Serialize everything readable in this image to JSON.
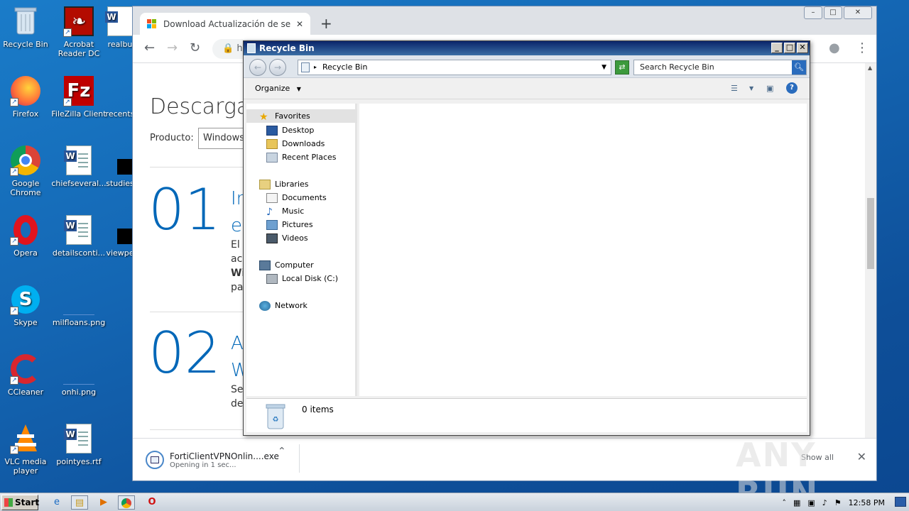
{
  "desktop": {
    "icons": [
      {
        "label": "Recycle Bin",
        "icon": "recycle-bin-icon"
      },
      {
        "label": "Acrobat Reader DC",
        "icon": "acrobat-icon"
      },
      {
        "label": "realbu",
        "icon": "word-doc-icon"
      },
      {
        "label": "Firefox",
        "icon": "firefox-icon"
      },
      {
        "label": "FileZilla Client",
        "icon": "filezilla-icon"
      },
      {
        "label": "recents",
        "icon": "file-icon"
      },
      {
        "label": "Google Chrome",
        "icon": "chrome-icon"
      },
      {
        "label": "chiefseveral...",
        "icon": "word-doc-icon"
      },
      {
        "label": "studies",
        "icon": "black-file-icon"
      },
      {
        "label": "Opera",
        "icon": "opera-icon"
      },
      {
        "label": "detailsconti...",
        "icon": "word-doc-icon"
      },
      {
        "label": "viewpe",
        "icon": "black-file-icon"
      },
      {
        "label": "Skype",
        "icon": "skype-icon"
      },
      {
        "label": "milfloans.png",
        "icon": "png-icon"
      },
      {
        "label": "CCleaner",
        "icon": "ccleaner-icon"
      },
      {
        "label": "onhi.png",
        "icon": "png-icon"
      },
      {
        "label": "VLC media player",
        "icon": "vlc-icon"
      },
      {
        "label": "pointyes.rtf",
        "icon": "word-doc-icon"
      }
    ]
  },
  "chrome": {
    "tab_title": "Download Actualización de segurida",
    "url": "ht",
    "page": {
      "heading": "Descargas",
      "product_label": "Producto:",
      "product_value": "Windows",
      "step1_num": "01",
      "step1_title1": "Ir",
      "step1_title2": "e",
      "step1_lines": [
        "El",
        "ac",
        "Wi",
        "pa"
      ],
      "step2_num": "02",
      "step2_title1": "A",
      "step2_title2": "W",
      "step2_lines": [
        "Se",
        "de"
      ]
    },
    "download": {
      "filename": "FortiClientVPNOnlin....exe",
      "status": "Opening in 1 sec...",
      "show_all": "Show all"
    }
  },
  "explorer": {
    "title": "Recycle Bin",
    "address": "Recycle Bin",
    "search_placeholder": "Search Recycle Bin",
    "organize": "Organize",
    "nav": {
      "favorites": "Favorites",
      "desktop": "Desktop",
      "downloads": "Downloads",
      "recent": "Recent Places",
      "libraries": "Libraries",
      "documents": "Documents",
      "music": "Music",
      "pictures": "Pictures",
      "videos": "Videos",
      "computer": "Computer",
      "localdisk": "Local Disk (C:)",
      "network": "Network"
    },
    "item_count": "0 items"
  },
  "taskbar": {
    "start": "Start",
    "clock": "12:58 PM"
  },
  "watermark": "ANY RUN"
}
